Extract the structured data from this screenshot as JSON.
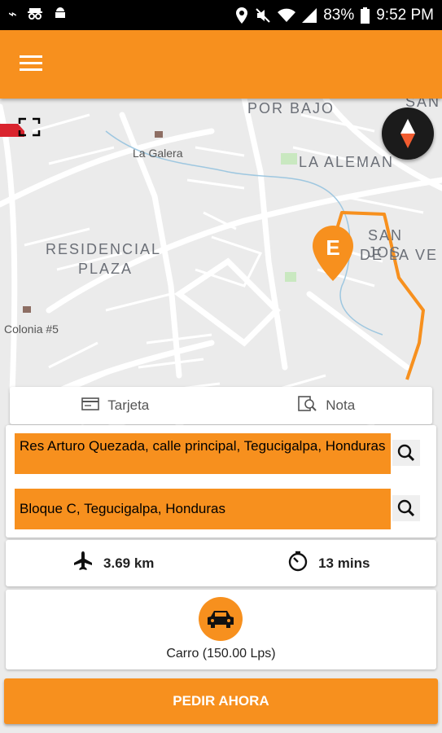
{
  "status_bar": {
    "battery": "83%",
    "time": "9:52 PM"
  },
  "map": {
    "labels": {
      "por_bajo": "POR BAJO",
      "la_galera": "La Galera",
      "la_aleman": "LA ALEMAN",
      "residencial": "RESIDENCIAL",
      "plaza": "PLAZA",
      "san_jose": "SAN JOS",
      "de_la_ve": "DE LA VE",
      "colonia": "Colonia #5",
      "san_top": "SAN"
    },
    "pin_letter": "E",
    "route_color": "#f7901e"
  },
  "tabs": {
    "card": "Tarjeta",
    "note": "Nota"
  },
  "addresses": {
    "pickup": "Res Arturo Quezada, calle principal, Tegucigalpa, Honduras",
    "destination": "Bloque C, Tegucigalpa, Honduras"
  },
  "trip": {
    "distance": "3.69 km",
    "duration": "13 mins"
  },
  "vehicle": {
    "label": "Carro (150.00 Lps)"
  },
  "order_button": "PEDIR AHORA",
  "colors": {
    "accent": "#f7901e",
    "status_bar": "#000000"
  }
}
